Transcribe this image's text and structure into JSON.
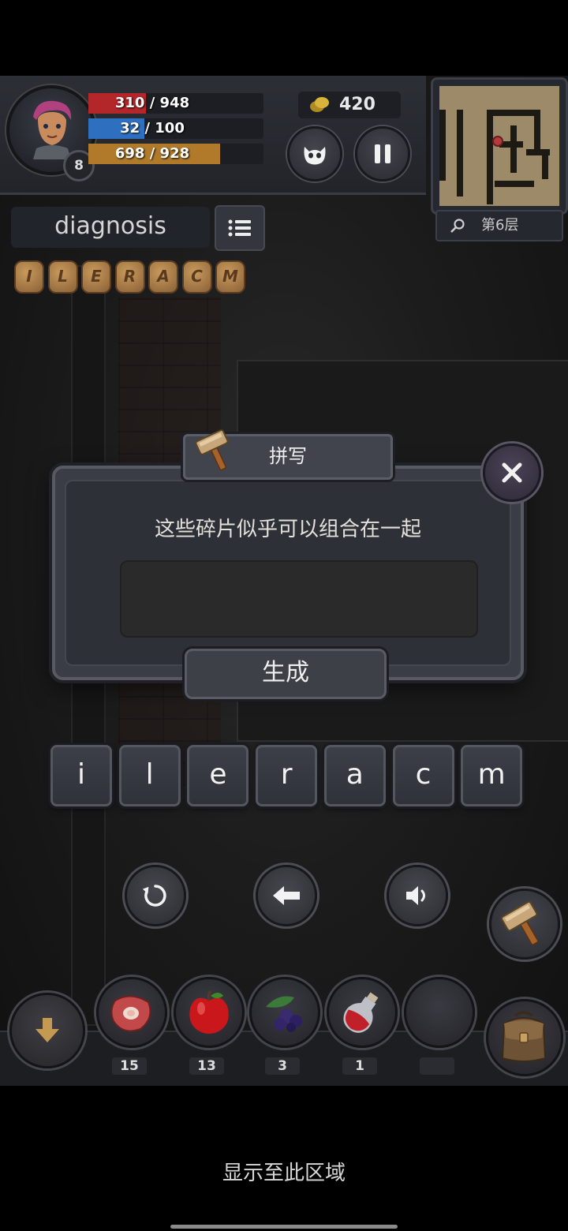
{
  "hud": {
    "hp_text": "310 / 948",
    "hp_ratio": 0.327,
    "mp_text": "32 / 100",
    "mp_ratio": 0.32,
    "xp_text": "698 / 928",
    "xp_ratio": 0.752,
    "level": "8",
    "coins": "420",
    "floor_label": "第6层",
    "colors": {
      "hp": "#b3262a",
      "mp": "#2f6fbf",
      "xp": "#b07a2a"
    }
  },
  "word": {
    "current": "diagnosis",
    "runes": [
      "I",
      "L",
      "E",
      "R",
      "A",
      "C",
      "M"
    ]
  },
  "dialog": {
    "title": "拼写",
    "prompt": "这些碎片似乎可以组合在一起",
    "input_value": "",
    "generate_label": "生成"
  },
  "letters": [
    "i",
    "l",
    "e",
    "r",
    "a",
    "c",
    "m"
  ],
  "inventory": {
    "items": [
      {
        "icon": "meat-icon",
        "count": "15"
      },
      {
        "icon": "apple-icon",
        "count": "13"
      },
      {
        "icon": "berries-icon",
        "count": "3"
      },
      {
        "icon": "potion-icon",
        "count": "1"
      },
      {
        "icon": "empty-slot",
        "count": ""
      }
    ]
  },
  "system": {
    "display_area_label": "显示至此区域"
  }
}
